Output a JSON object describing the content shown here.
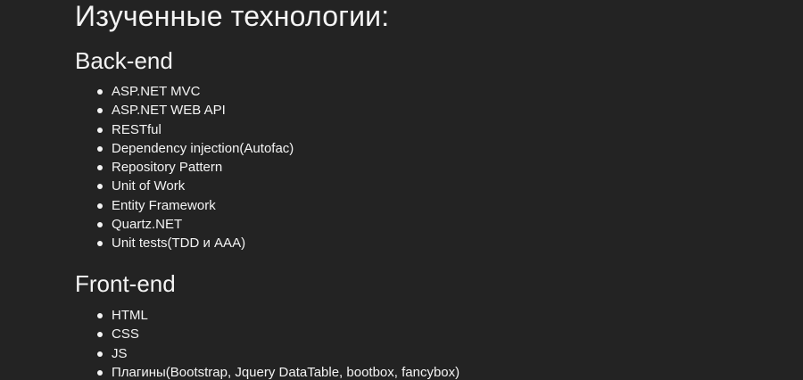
{
  "page": {
    "title": "Изученные технологии:"
  },
  "sections": [
    {
      "title": "Back-end",
      "items": [
        "ASP.NET MVC",
        "ASP.NET WEB API",
        "RESTful",
        "Dependency injection(Autofac)",
        "Repository Pattern",
        "Unit of Work",
        "Entity Framework",
        "Quartz.NET",
        "Unit tests(TDD и AAA)"
      ]
    },
    {
      "title": "Front-end",
      "items": [
        "HTML",
        "CSS",
        "JS",
        "Плагины(Bootstrap, Jquery DataTable, bootbox, fancybox)"
      ]
    }
  ]
}
